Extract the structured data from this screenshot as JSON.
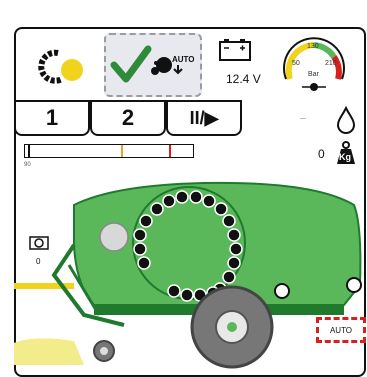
{
  "status": {
    "battery_voltage": "12.4 V",
    "gauge_unit": "Bar",
    "gauge_scale_labels": [
      "50",
      "130",
      "210"
    ],
    "net_wrap_mode": "AUTO",
    "weight_value": "0",
    "weight_unit": "Kg",
    "bale_count": "0",
    "dashes": "---",
    "progress_tick_label": "90"
  },
  "tabs": [
    {
      "label": "1"
    },
    {
      "label": "2"
    },
    {
      "label": "II/▶"
    }
  ],
  "indicators": {
    "auto_zone_label": "AUTO"
  },
  "progress": {
    "left_marker_fraction": 0.02,
    "orange_marker_fraction": 0.57,
    "red_marker_fraction": 0.86
  },
  "colors": {
    "machine_green": "#5bb85a",
    "dark_green": "#1f7a2e",
    "check_green": "#2e8b3a",
    "warning_red": "#d61f1f",
    "accent_yellow": "#f2d31b",
    "orange_marker": "#f0a030"
  },
  "icons": [
    "chain-sprocket-icon",
    "auto-lube-icon",
    "battery-icon",
    "pressure-gauge-icon",
    "oil-drop-icon",
    "weight-icon",
    "bale-counter-icon"
  ]
}
